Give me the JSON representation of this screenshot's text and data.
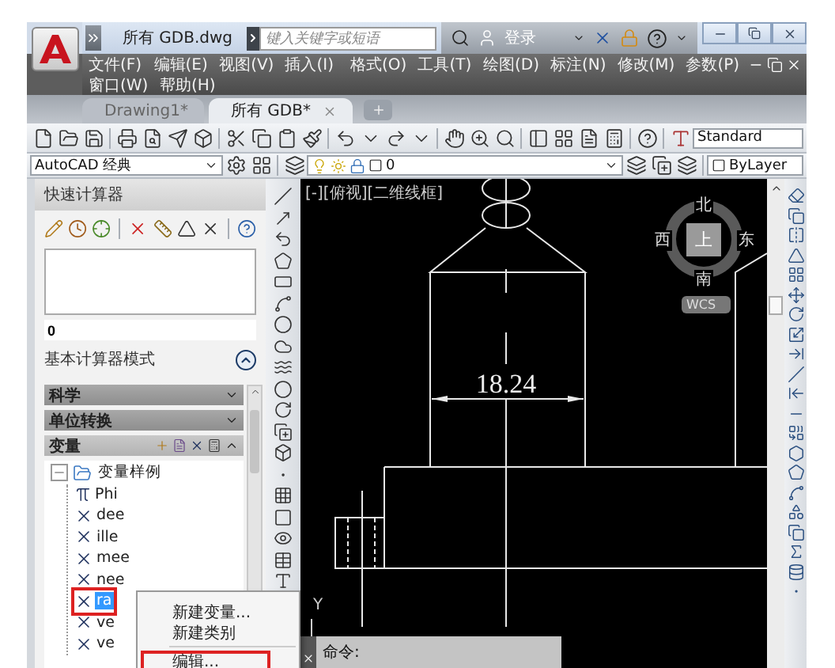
{
  "title_bar": {
    "title": "所有 GDB.dwg",
    "search_placeholder": "键入关键字或短语",
    "sign_in": "登录"
  },
  "menu_bar": {
    "rows": [
      [
        "文件(F)",
        "编辑(E)",
        "视图(V)",
        "插入(I)",
        "格式(O)",
        "工具(T)",
        "绘图(D)",
        "标注(N)",
        "修改(M)",
        "参数(P)"
      ],
      [
        "窗口(W)",
        "帮助(H)"
      ]
    ]
  },
  "tabs": [
    {
      "label": "Drawing1*",
      "selected": false
    },
    {
      "label": "所有 GDB*",
      "selected": true
    }
  ],
  "toolbar": {
    "text_style": "Standard",
    "workspace": "AutoCAD 经典",
    "layer": "0",
    "line_setting": "ByLayer"
  },
  "quick_calc": {
    "title": "快速计算器",
    "value": "0",
    "mode": "基本计算器模式",
    "sections": [
      {
        "label": "科学",
        "expanded": false
      },
      {
        "label": "单位转换",
        "expanded": false
      },
      {
        "label": "变量",
        "expanded": true
      }
    ],
    "tree": {
      "label": "变量样例",
      "expanded": true,
      "children": [
        {
          "label": "Phi",
          "kind": "constant",
          "selected": false
        },
        {
          "label": "dee",
          "kind": "variable",
          "selected": false
        },
        {
          "label": "ille",
          "kind": "variable",
          "selected": false
        },
        {
          "label": "mee",
          "kind": "variable",
          "selected": false
        },
        {
          "label": "nee",
          "kind": "variable",
          "selected": false
        },
        {
          "label": "ra",
          "kind": "variable",
          "selected": true
        },
        {
          "label": "ve",
          "kind": "variable",
          "selected": false
        },
        {
          "label": "ve",
          "kind": "variable",
          "selected": false
        }
      ]
    }
  },
  "context_menu": {
    "items": [
      {
        "kind": "command",
        "label": "新建变量...",
        "highlighted": false
      },
      {
        "kind": "command",
        "label": "新建类别",
        "highlighted": false
      },
      {
        "kind": "separator"
      },
      {
        "kind": "command",
        "label": "编辑...",
        "highlighted": true
      }
    ]
  },
  "viewport": {
    "label": "[-][俯视][二维线框]",
    "dimension": "18.24",
    "viewcube": {
      "north": "北",
      "west": "西",
      "east": "东",
      "south": "南",
      "face": "上",
      "wcs": "WCS"
    },
    "ucs_label": "Y",
    "command_prompt": "命令:"
  }
}
